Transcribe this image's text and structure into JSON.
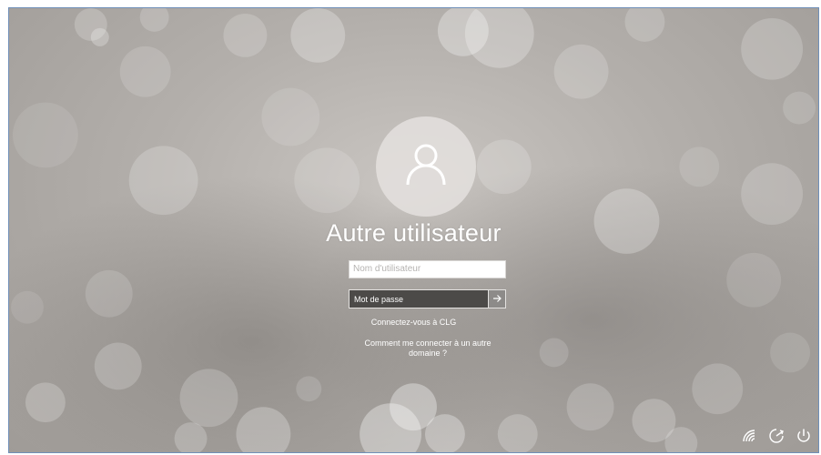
{
  "login": {
    "user_name": "Autre utilisateur",
    "username_placeholder": "Nom d'utilisateur",
    "password_placeholder": "Mot de passe",
    "connect_link": "Connectez-vous à CLG",
    "help_link": "Comment me connecter à un autre domaine ?"
  },
  "icons": {
    "avatar": "user-icon",
    "submit": "arrow-right-icon",
    "tray": [
      "network-icon",
      "ease-of-access-icon",
      "power-icon"
    ]
  },
  "colors": {
    "password_field": "#4c4a48",
    "submit_button": "#8d8b89",
    "text": "#ffffff"
  }
}
